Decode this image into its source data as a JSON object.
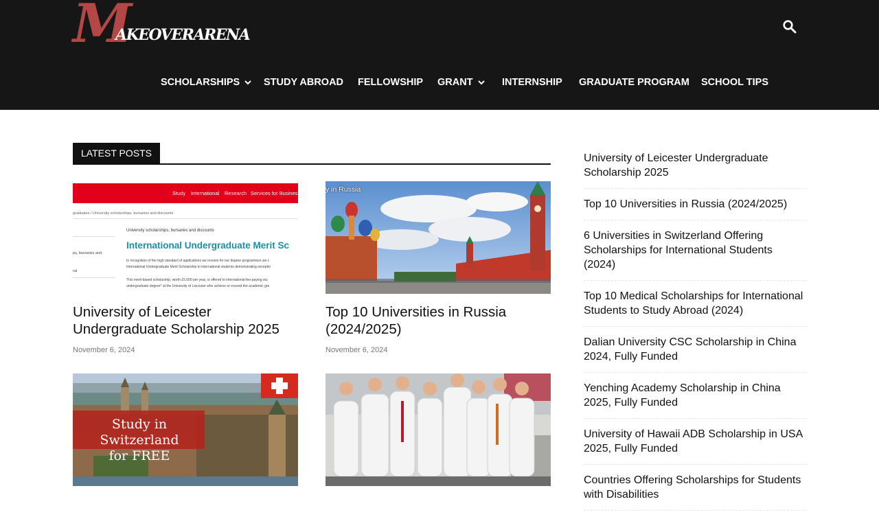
{
  "brand": {
    "logo_initial": "M",
    "logo_rest": "AKEOVERARENA"
  },
  "header": {
    "search_icon": "search-icon",
    "nav": [
      {
        "label": "SCHOLARSHIPS",
        "has_dropdown": true
      },
      {
        "label": "STUDY ABROAD",
        "has_dropdown": false
      },
      {
        "label": "FELLOWSHIP",
        "has_dropdown": false
      },
      {
        "label": "GRANT",
        "has_dropdown": true
      },
      {
        "label": "INTERNSHIP",
        "has_dropdown": false
      },
      {
        "label": "GRADUATE PROGRAM",
        "has_dropdown": false
      },
      {
        "label": "SCHOOL TIPS",
        "has_dropdown": false
      }
    ]
  },
  "latest": {
    "title": "LATEST POSTS",
    "posts": [
      {
        "title": "University of Leicester Undergraduate Scholarship 2025",
        "date": "November 6, 2024",
        "thumb": {
          "nav_links": [
            "Study",
            "International",
            "Research",
            "Services for Busines"
          ],
          "breadcrumb": "graduates  /  University scholarships, bursaries and discounts",
          "kicker": "University scholarships, bursaries and discounts",
          "heading": "International Undergraduate Merit Sc",
          "side_text": "ps, bursaries and",
          "side_text2": "ral",
          "body1": "In recognition of the high standard of applications we receive for our degree programmes we c",
          "body2": "International Undergraduate Merit Scholarship to international students demonstrating exceptio",
          "body3": "This merit-based scholarship, worth £5,000 per year, is offered to international-fee-paying stu",
          "body4": "undergraduate degree* at the University of Leicester who achieve or exceed the academic gra"
        }
      },
      {
        "title": "Top 10 Universities in Russia (2024/2025)",
        "date": "November 6, 2024",
        "thumb": {
          "caption": "y in Russia"
        }
      },
      {
        "title": "",
        "date": "",
        "thumb": {
          "line1": "Study in Switzerland",
          "line2": "for FREE"
        }
      },
      {
        "title": "",
        "date": "",
        "thumb": {}
      }
    ]
  },
  "sidebar": {
    "items": [
      "University of Leicester Undergraduate Scholarship 2025",
      "Top 10 Universities in Russia (2024/2025)",
      "6 Universities in Switzerland Offering Scholarships for International Students (2024)",
      "Top 10 Medical Scholarships for International Students to Study Abroad (2024)",
      "Dalian University CSC Scholarship in China 2024, Fully Funded",
      "Yenching Academy Scholarship in China 2025, Fully Funded",
      "University of Hawaii ADB Scholarship in USA 2025, Fully Funded",
      "Countries Offering Scholarships for Students with Disabilities"
    ]
  },
  "colors": {
    "header_bg": "#161616",
    "logo_red": "#b34745",
    "leicester_red": "#e2001a",
    "leicester_teal": "#1a8fa8"
  }
}
